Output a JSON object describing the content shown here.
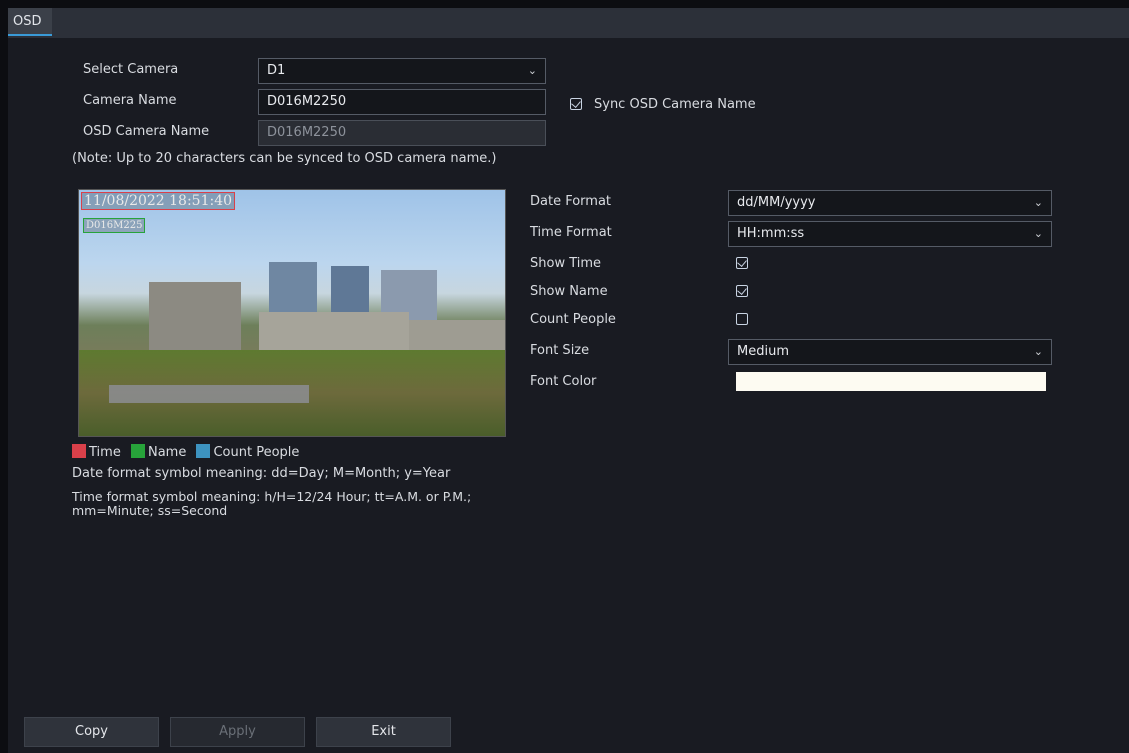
{
  "tabs": [
    {
      "label": "OSD"
    }
  ],
  "camera": {
    "select_label": "Select Camera",
    "select_value": "D1",
    "name_label": "Camera Name",
    "name_value": "D016M2250",
    "sync_label": "Sync OSD Camera Name",
    "sync_checked": true,
    "osd_name_label": "OSD Camera Name",
    "osd_name_value": "D016M2250",
    "note": "(Note: Up to 20 characters can be synced to OSD camera name.)"
  },
  "preview": {
    "osd_time_text": "11/08/2022 18:51:40",
    "osd_name_text": "D016M225"
  },
  "legend": {
    "time": "Time",
    "name": "Name",
    "count": "Count People",
    "colors": {
      "time": "#d9404a",
      "name": "#27a33a",
      "count": "#3d93c0"
    }
  },
  "help": {
    "date": "Date format symbol meaning: dd=Day; M=Month; y=Year",
    "time_line1": "Time format symbol meaning: h/H=12/24 Hour; tt=A.M. or P.M.;",
    "time_line2": "mm=Minute; ss=Second"
  },
  "settings": {
    "date_format_label": "Date Format",
    "date_format_value": "dd/MM/yyyy",
    "time_format_label": "Time Format",
    "time_format_value": "HH:mm:ss",
    "show_time_label": "Show Time",
    "show_time_checked": true,
    "show_name_label": "Show Name",
    "show_name_checked": true,
    "count_people_label": "Count People",
    "count_people_checked": false,
    "font_size_label": "Font Size",
    "font_size_value": "Medium",
    "font_color_label": "Font Color",
    "font_color_value": "#fdfbf2"
  },
  "buttons": {
    "copy": "Copy",
    "apply": "Apply",
    "exit": "Exit"
  },
  "icons": {
    "dropdown": "chevron-down-icon",
    "checkbox": "checkbox-icon"
  }
}
